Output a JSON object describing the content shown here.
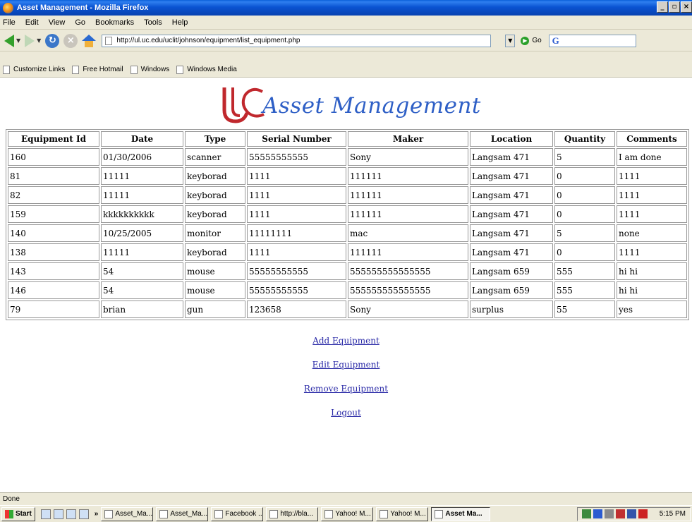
{
  "window": {
    "title": "Asset Management - Mozilla Firefox",
    "controls": [
      "_",
      "▫",
      "×"
    ]
  },
  "menu": [
    "File",
    "Edit",
    "View",
    "Go",
    "Bookmarks",
    "Tools",
    "Help"
  ],
  "nav": {
    "url": "http://ul.uc.edu/uclit/johnson/equipment/list_equipment.php",
    "go_label": "Go"
  },
  "bookmarks": [
    "Customize Links",
    "Free Hotmail",
    "Windows",
    "Windows Media"
  ],
  "page": {
    "logo_text": "Asset Management",
    "table": {
      "headers": [
        "Equipment Id",
        "Date",
        "Type",
        "Serial Number",
        "Maker",
        "Location",
        "Quantity",
        "Comments"
      ],
      "rows": [
        [
          "160",
          "01/30/2006",
          "scanner",
          "55555555555",
          "Sony",
          "Langsam 471",
          "5",
          "I am done"
        ],
        [
          "81",
          "11111",
          "keyborad",
          "1111",
          "111111",
          "Langsam 471",
          "0",
          "1111"
        ],
        [
          "82",
          "11111",
          "keyborad",
          "1111",
          "111111",
          "Langsam 471",
          "0",
          "1111"
        ],
        [
          "159",
          "kkkkkkkkkk",
          "keyborad",
          "1111",
          "111111",
          "Langsam 471",
          "0",
          "1111"
        ],
        [
          "140",
          "10/25/2005",
          "monitor",
          "11111111",
          "mac",
          "Langsam 471",
          "5",
          "none"
        ],
        [
          "138",
          "11111",
          "keyborad",
          "1111",
          "111111",
          "Langsam 471",
          "0",
          "1111"
        ],
        [
          "143",
          "54",
          "mouse",
          "55555555555",
          "555555555555555",
          "Langsam 659",
          "555",
          "hi hi"
        ],
        [
          "146",
          "54",
          "mouse",
          "55555555555",
          "555555555555555",
          "Langsam 659",
          "555",
          "hi hi"
        ],
        [
          "79",
          "brian",
          "gun",
          "123658",
          "Sony",
          "surplus",
          "55",
          "yes"
        ]
      ]
    },
    "links": [
      "Add Equipment",
      "Edit Equipment",
      "Remove Equipment",
      "Logout"
    ]
  },
  "status": "Done",
  "taskbar": {
    "start": "Start",
    "chevron": "»",
    "tasks": [
      "Asset_Ma...",
      "Asset_Ma...",
      "Facebook ...",
      "http://bla...",
      "Yahoo! M...",
      "Yahoo! M...",
      "Asset Ma..."
    ],
    "clock": "5:15 PM"
  },
  "colors": {
    "logo_blue": "#2e5fc6",
    "logo_red": "#c0282d",
    "link": "#2c2ca8",
    "titlebar": "#0a53d2"
  }
}
